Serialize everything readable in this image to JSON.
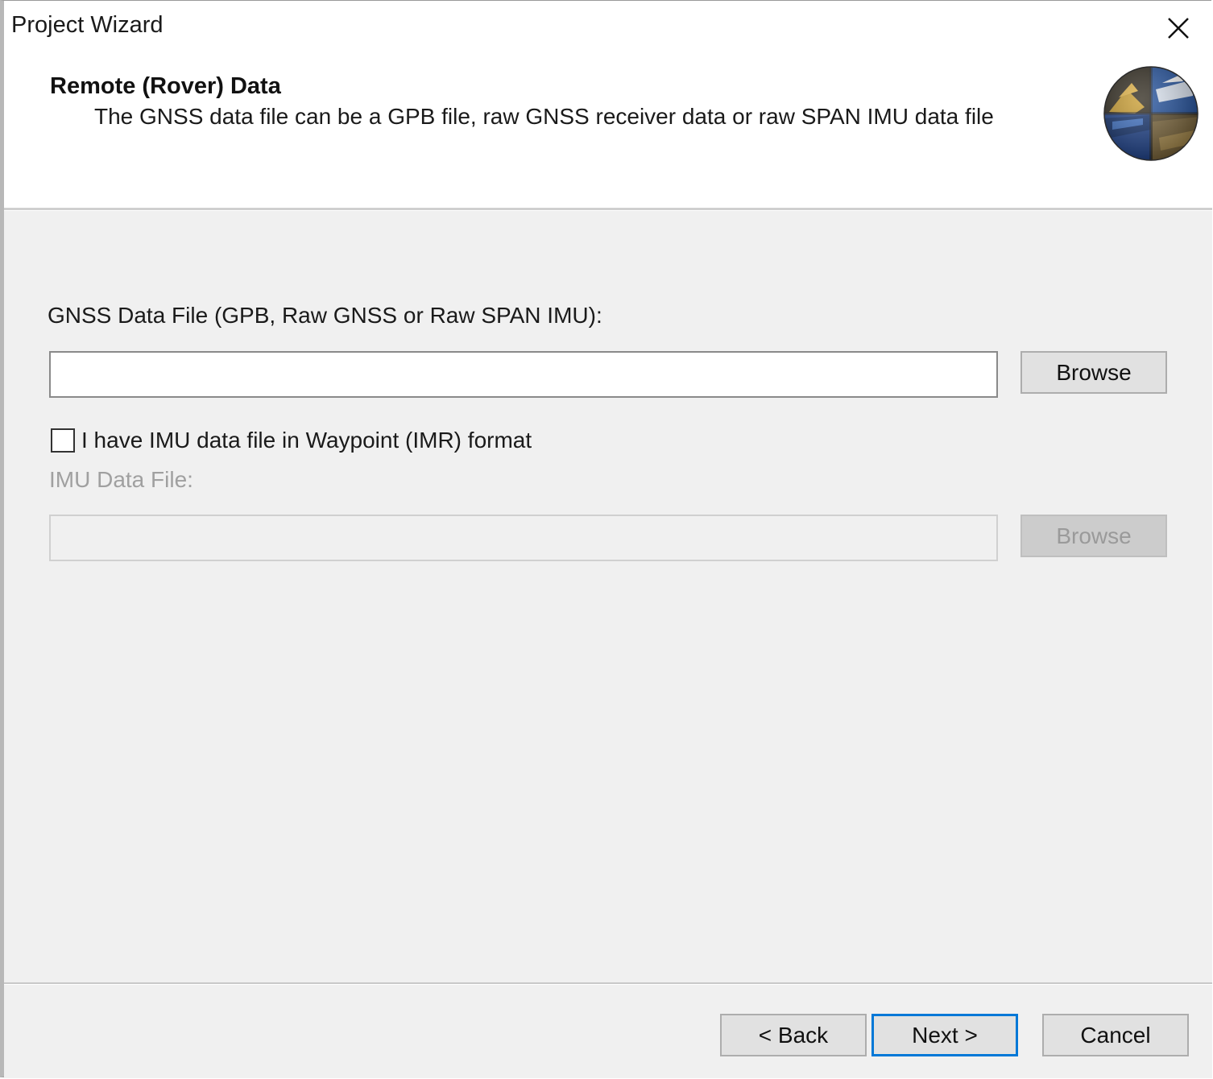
{
  "window": {
    "title": "Project Wizard",
    "close_icon": "close-icon"
  },
  "header": {
    "title": "Remote (Rover) Data",
    "subtitle": "The GNSS data file can be a GPB file, raw GNSS receiver data or raw SPAN IMU data file",
    "logo_icon": "globe-logo-icon"
  },
  "form": {
    "gnss_label": "GNSS Data File (GPB, Raw GNSS or Raw SPAN IMU):",
    "gnss_value": "",
    "gnss_browse_label": "Browse",
    "imu_checkbox_label": "I have IMU data file in Waypoint (IMR) format",
    "imu_checkbox_checked": false,
    "imu_label": "IMU Data File:",
    "imu_value": "",
    "imu_browse_label": "Browse",
    "imu_enabled": false
  },
  "footer": {
    "back_label": "< Back",
    "next_label": "Next >",
    "cancel_label": "Cancel"
  },
  "colors": {
    "focus_accent": "#0078d7",
    "panel_bg": "#f0f0f0",
    "disabled_text": "#a0a0a0"
  }
}
